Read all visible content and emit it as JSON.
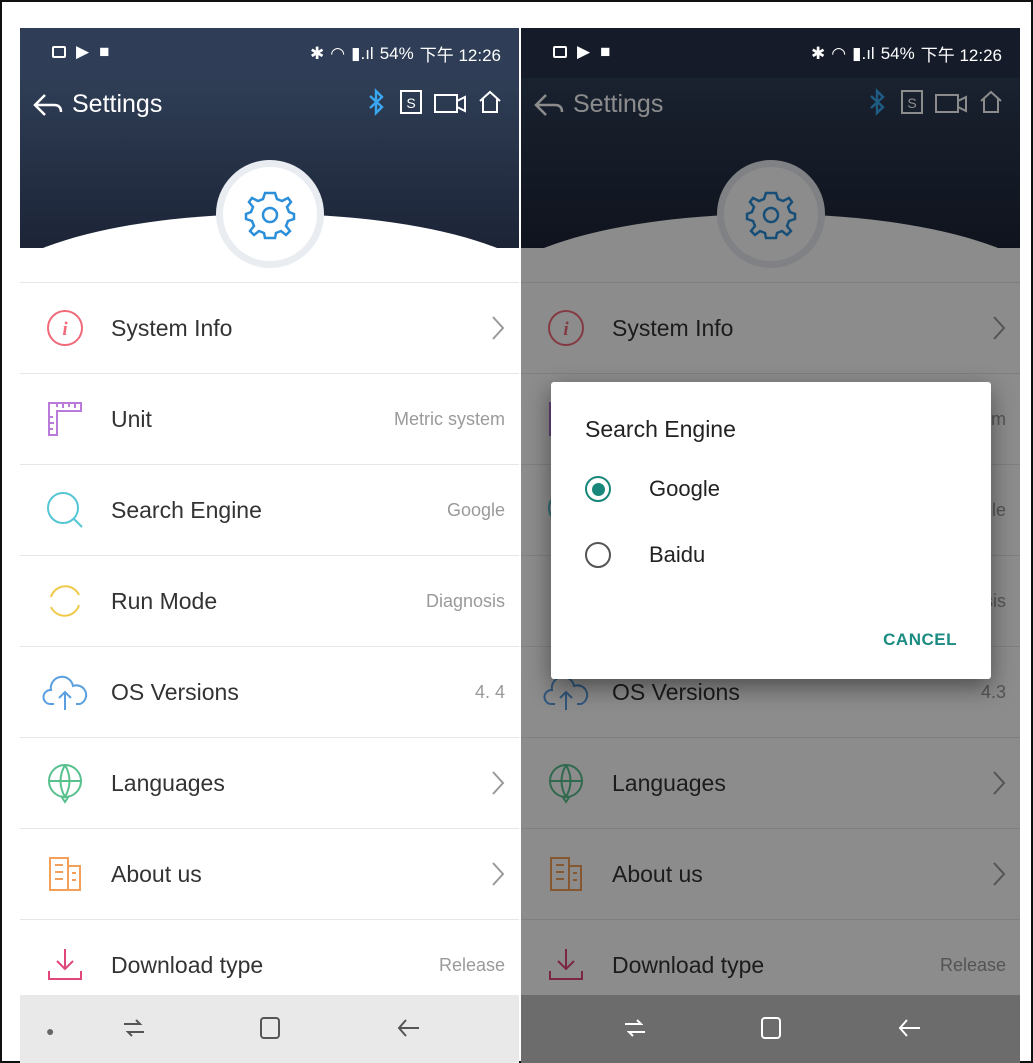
{
  "status": {
    "battery": "54%",
    "time": "下午 12:26"
  },
  "header": {
    "title": "Settings"
  },
  "settings": [
    {
      "key": "system-info",
      "label": "System Info",
      "value": "",
      "chevron": true,
      "icon": "info-icon",
      "color": "#f06a78"
    },
    {
      "key": "unit",
      "label": "Unit",
      "value": "Metric system",
      "chevron": false,
      "icon": "ruler-icon",
      "color": "#b97ad9"
    },
    {
      "key": "search-engine",
      "label": "Search Engine",
      "value": "Google",
      "chevron": false,
      "icon": "search-icon",
      "color": "#55c6d6"
    },
    {
      "key": "run-mode",
      "label": "Run Mode",
      "value": "Diagnosis",
      "chevron": false,
      "icon": "cycle-icon",
      "color": "#eec94a"
    },
    {
      "key": "os-versions",
      "label": "OS Versions",
      "value": "4. 4",
      "chevron": false,
      "icon": "cloud-upload-icon",
      "color": "#5a9fe0"
    },
    {
      "key": "languages",
      "label": "Languages",
      "value": "",
      "chevron": true,
      "icon": "globe-icon",
      "color": "#58c08d"
    },
    {
      "key": "about-us",
      "label": "About us",
      "value": "",
      "chevron": true,
      "icon": "building-icon",
      "color": "#f3a05b"
    },
    {
      "key": "download-type",
      "label": "Download type",
      "value": "Release",
      "chevron": false,
      "icon": "download-icon",
      "color": "#e0487b"
    }
  ],
  "dialog": {
    "title": "Search Engine",
    "options": [
      {
        "label": "Google",
        "selected": true
      },
      {
        "label": "Baidu",
        "selected": false
      }
    ],
    "cancel": "CANCEL"
  },
  "dimmed_values": {
    "os_versions": "4.3"
  }
}
